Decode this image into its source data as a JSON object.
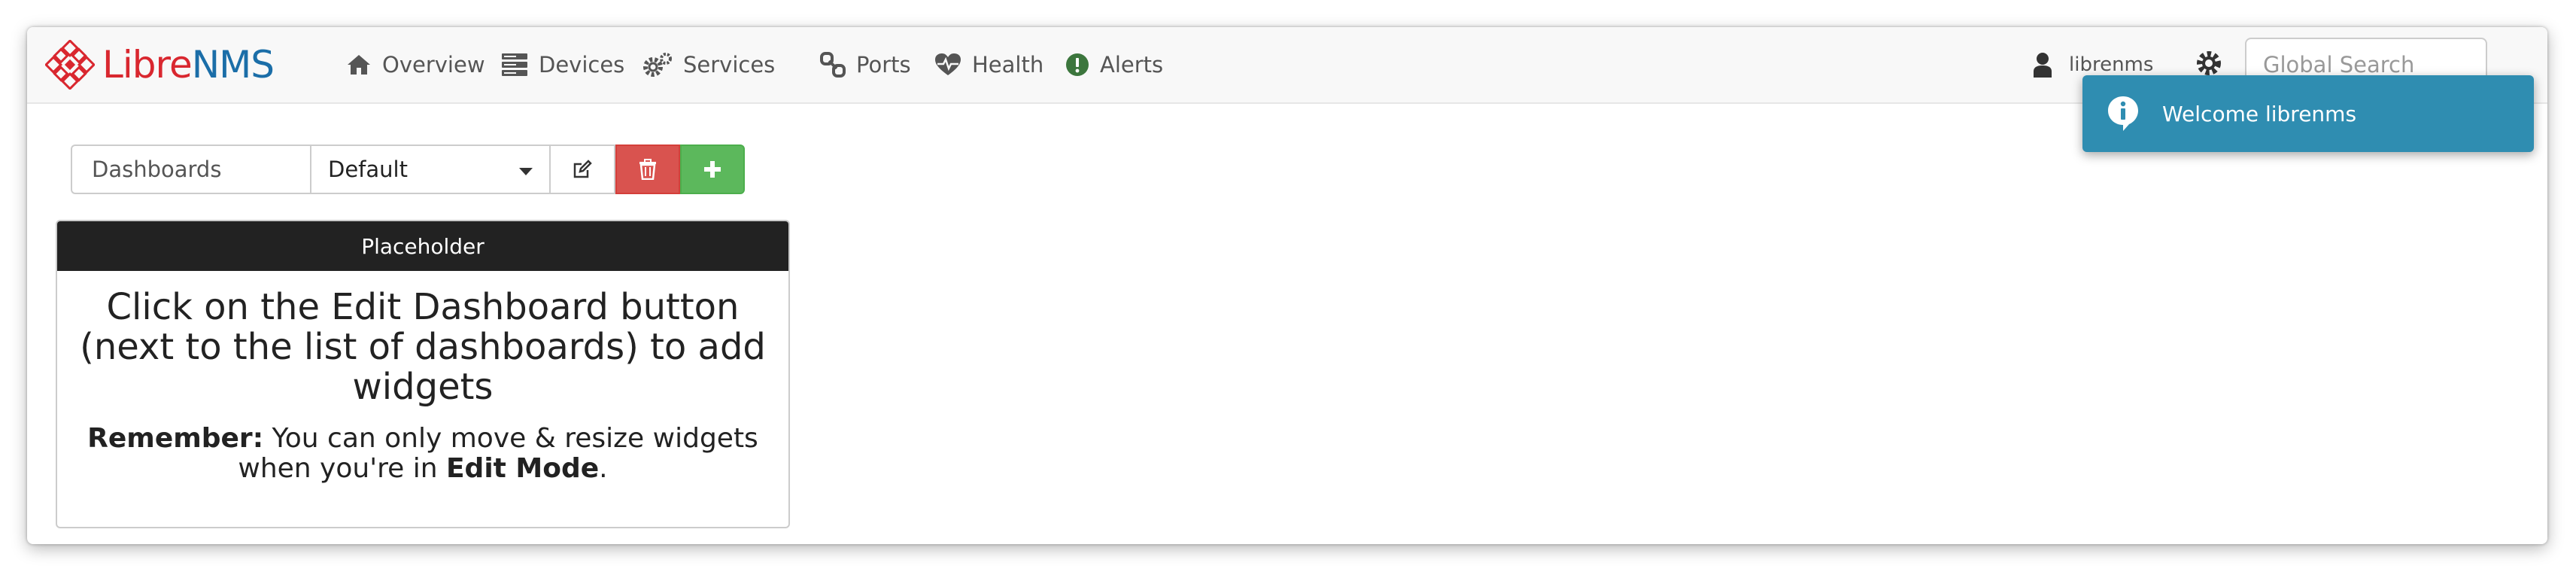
{
  "brand": {
    "part1": "Libre",
    "part2": "NMS"
  },
  "nav": {
    "items": [
      {
        "label": "Overview",
        "icon": "home-icon"
      },
      {
        "label": "Devices",
        "icon": "server-icon"
      },
      {
        "label": "Services",
        "icon": "cogs-icon"
      },
      {
        "label": "Ports",
        "icon": "link-icon"
      },
      {
        "label": "Health",
        "icon": "heartbeat-icon"
      },
      {
        "label": "Alerts",
        "icon": "exclamation-circle-icon"
      }
    ],
    "user": "librenms",
    "search_placeholder": "Global Search"
  },
  "toast": {
    "message": "Welcome librenms",
    "icon": "info-icon",
    "color": "#2f8db1"
  },
  "toolbar": {
    "label": "Dashboards",
    "selected": "Default"
  },
  "widget": {
    "title": "Placeholder",
    "message": "Click on the Edit Dashboard button (next to the list of dashboards) to add widgets",
    "note_bold": "Remember:",
    "note_text": " You can only move & resize widgets when you're in ",
    "note_mode": "Edit Mode",
    "note_end": "."
  },
  "colors": {
    "danger": "#d9534f",
    "success": "#5cb85c",
    "header": "#222222"
  }
}
